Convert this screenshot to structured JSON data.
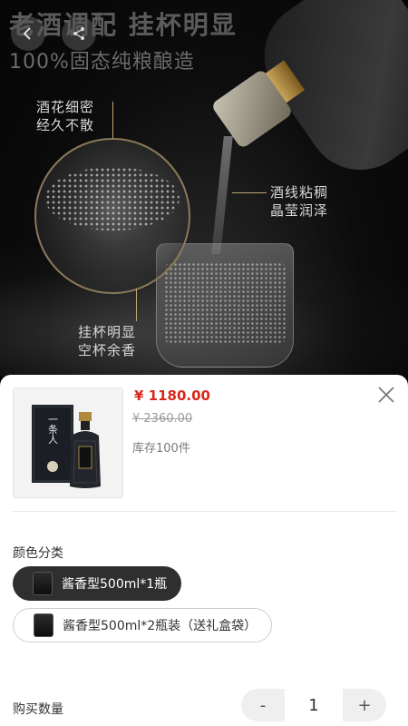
{
  "hero": {
    "title": "老酒调配  挂杯明显",
    "subtitle": "100%固态纯粮酿造",
    "annotation_top_left": [
      "酒花细密",
      "经久不散"
    ],
    "annotation_right": [
      "酒线粘稠",
      "晶莹润泽"
    ],
    "annotation_bottom": [
      "挂杯明显",
      "空杯余香"
    ],
    "thumb_brand": "一条人"
  },
  "product": {
    "price": "¥ 1180.00",
    "original_price": "¥ 2360.00",
    "stock": "库存100件"
  },
  "color_section": {
    "label": "颜色分类",
    "options": [
      {
        "label": "酱香型500ml*1瓶",
        "selected": true
      },
      {
        "label": "酱香型500ml*2瓶装（送礼盒袋）",
        "selected": false
      }
    ]
  },
  "quantity_section": {
    "label": "购买数量",
    "minus": "-",
    "value": "1",
    "plus": "+"
  },
  "colors": {
    "price_red": "#d8281b",
    "selected_option_bg": "#2f2f2f"
  },
  "icons": [
    "back-icon",
    "share-icon",
    "close-icon"
  ]
}
